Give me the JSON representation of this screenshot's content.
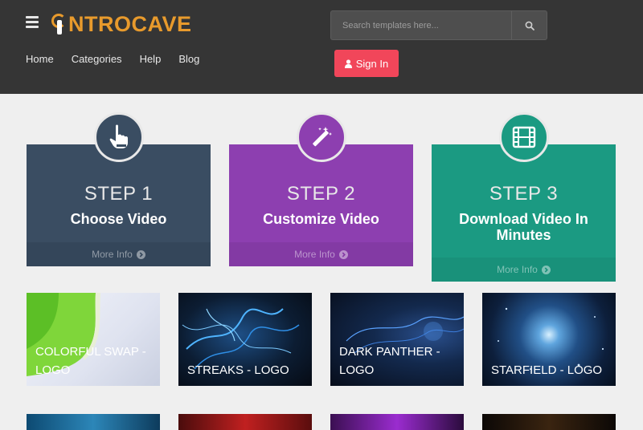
{
  "header": {
    "logo_text": "NTROCAVE",
    "logo_initial": "I",
    "nav": [
      "Home",
      "Categories",
      "Help",
      "Blog"
    ],
    "search_placeholder": "Search templates here...",
    "signin_label": "Sign In"
  },
  "steps": [
    {
      "title": "STEP 1",
      "subtitle": "Choose Video",
      "more": "More Info",
      "icon": "pointer-hand-icon",
      "color": "#3a4d62"
    },
    {
      "title": "STEP 2",
      "subtitle": "Customize Video",
      "more": "More Info",
      "icon": "magic-wand-icon",
      "color": "#8d3fb0"
    },
    {
      "title": "STEP 3",
      "subtitle": "Download Video In Minutes",
      "more": "More Info",
      "icon": "film-icon",
      "color": "#1b9a82"
    }
  ],
  "templates": [
    {
      "label": "COLORFUL SWAP - LOGO"
    },
    {
      "label": "STREAKS - LOGO"
    },
    {
      "label": "DARK PANTHER - LOGO"
    },
    {
      "label": "STARFIELD - LOGO"
    }
  ],
  "colors": {
    "header_bg": "#353535",
    "accent_orange": "#e89a2c",
    "signin_red": "#f1465a",
    "page_bg": "#efefef"
  }
}
